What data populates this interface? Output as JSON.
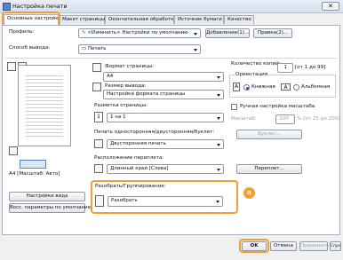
{
  "window": {
    "title": "Настройка печати",
    "close_glyph": "✕"
  },
  "tabs": [
    {
      "label": "Основные настройки"
    },
    {
      "label": "Макет страницы"
    },
    {
      "label": "Окончательная обработка"
    },
    {
      "label": "Источник бумаги"
    },
    {
      "label": "Качество"
    }
  ],
  "profile": {
    "label": "Профиль:",
    "value": "<Изменить> Настройки по умолчанию",
    "add_button": "Добавление(1)...",
    "edit_button": "Правка(2)..."
  },
  "output": {
    "label": "Способ вывода:",
    "value": "Печать"
  },
  "preview": {
    "caption": "A4 [Масштаб: Авто]",
    "settings_button": "Настройки вида",
    "restore_button": "Восс. параметры по умолчанию"
  },
  "page_size": {
    "label": "Формат страницы:",
    "value": "A4"
  },
  "output_size": {
    "label": "Размер вывода:",
    "value": "Настройка формата страницы"
  },
  "copies": {
    "label": "Количество копий:",
    "value": "1",
    "range": "[от 1 до 99]"
  },
  "orientation": {
    "label": "Ориентация",
    "portrait": "Книжная",
    "landscape": "Альбомная",
    "portrait_glyph": "A",
    "landscape_glyph": "A"
  },
  "layout": {
    "label": "Разметка страницы:",
    "value": "1 на 1",
    "glyph": "1"
  },
  "manual_scale": {
    "label": "Ручная настройка масштаба",
    "field_label": "Масштаб:",
    "value": "100",
    "range": "% [от 25 до 200]"
  },
  "duplex": {
    "label": "Печать односторонняя/двусторонняя/буклет:",
    "value": "Двусторонняя печать",
    "booklet_button": "Буклет..."
  },
  "binding": {
    "label": "Расположение переплета:",
    "value": "Длинный край [Слева]",
    "gutter_button": "Переплет..."
  },
  "collate": {
    "label": "Разобрать/Группирование:",
    "value": "Разобрать"
  },
  "callout": {
    "letter": "a"
  },
  "dialog_buttons": {
    "ok": "OK",
    "cancel": "Отмена",
    "apply": "Применить",
    "help": "Справка"
  }
}
